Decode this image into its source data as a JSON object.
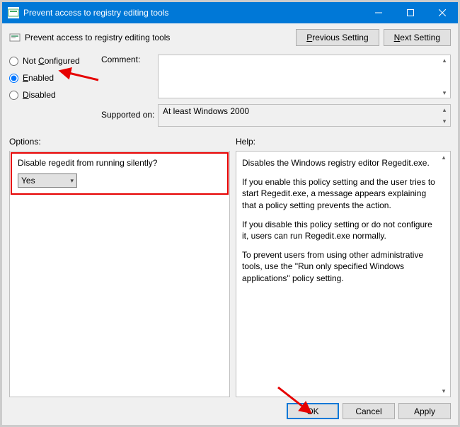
{
  "window": {
    "title": "Prevent access to registry editing tools"
  },
  "header": {
    "title": "Prevent access to registry editing tools",
    "prev_label": "Previous Setting",
    "next_label": "Next Setting"
  },
  "radios": {
    "not_configured": "Not Configured",
    "enabled": "Enabled",
    "disabled": "Disabled",
    "selected": "enabled"
  },
  "fields": {
    "comment_label": "Comment:",
    "comment_value": "",
    "supported_label": "Supported on:",
    "supported_value": "At least Windows 2000"
  },
  "sections": {
    "options_label": "Options:",
    "help_label": "Help:"
  },
  "options": {
    "disable_silent_label": "Disable regedit from running silently?",
    "disable_silent_value": "Yes"
  },
  "help": {
    "p1": "Disables the Windows registry editor Regedit.exe.",
    "p2": "If you enable this policy setting and the user tries to start Regedit.exe, a message appears explaining that a policy setting prevents the action.",
    "p3": "If you disable this policy setting or do not configure it, users can run Regedit.exe normally.",
    "p4": "To prevent users from using other administrative tools, use the \"Run only specified Windows applications\" policy setting."
  },
  "footer": {
    "ok": "OK",
    "cancel": "Cancel",
    "apply": "Apply"
  }
}
